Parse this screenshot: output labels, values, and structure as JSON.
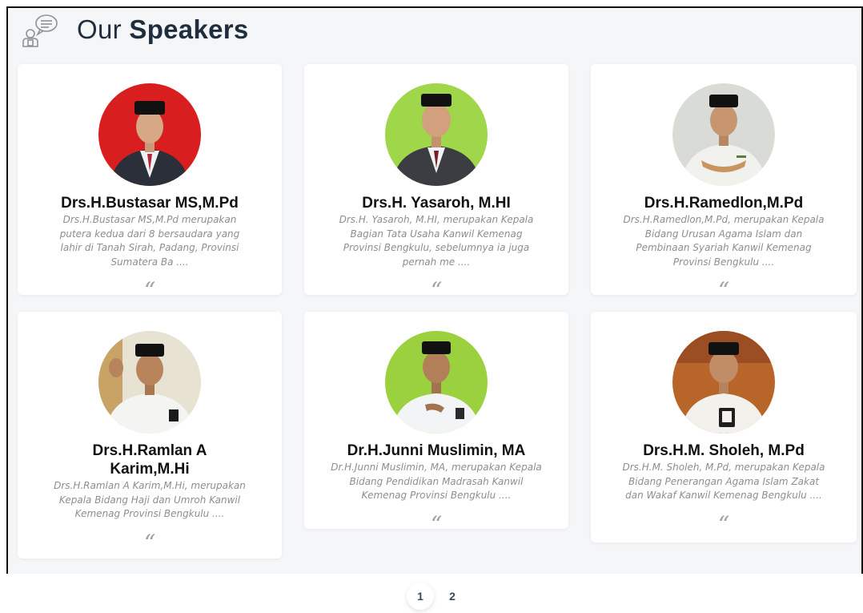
{
  "section": {
    "title_light": "Our",
    "title_bold": "Speakers",
    "icon": "speaker-chat-icon"
  },
  "speakers": [
    {
      "name": "Drs.H.Bustasar MS,M.Pd",
      "description": "Drs.H.Bustasar MS,M.Pd merupakan putera kedua dari 8 bersaudara yang lahir di Tanah Sirah, Padang, Provinsi Sumatera Ba ....",
      "quote_icon": "“",
      "photo_bg": "#d81e1e"
    },
    {
      "name": "Drs.H. Yasaroh, M.HI",
      "description": "Drs.H. Yasaroh, M.HI, merupakan Kepala Bagian Tata Usaha Kanwil Kemenag Provinsi Bengkulu, sebelumnya ia juga pernah me ....",
      "quote_icon": "“",
      "photo_bg": "#9fd64a"
    },
    {
      "name": "Drs.H.Ramedlon,M.Pd",
      "description": "Drs.H.Ramedlon,M.Pd, merupakan Kepala Bidang Urusan Agama Islam dan Pembinaan Syariah Kanwil Kemenag Provinsi Bengkulu ....",
      "quote_icon": "“",
      "photo_bg": "#d9dcd6"
    },
    {
      "name": "Drs.H.Ramlan A Karim,M.Hi",
      "description": "Drs.H.Ramlan A Karim,M.Hi, merupakan Kepala Bidang Haji dan Umroh Kanwil Kemenag Provinsi Bengkulu ....",
      "quote_icon": "“",
      "photo_bg": "#e8e2d2"
    },
    {
      "name": "Dr.H.Junni Muslimin, MA",
      "description": "Dr.H.Junni Muslimin, MA, merupakan Kepala Bidang Pendidikan Madrasah Kanwil Kemenag Provinsi Bengkulu ....",
      "quote_icon": "“",
      "photo_bg": "#9bd03e"
    },
    {
      "name": "Drs.H.M. Sholeh, M.Pd",
      "description": "Drs.H.M. Sholeh, M.Pd, merupakan Kepala Bidang Penerangan Agama Islam Zakat dan Wakaf Kanwil Kemenag Bengkulu ....",
      "quote_icon": "“",
      "photo_bg": "#b8652a"
    }
  ],
  "pagination": {
    "pages": [
      "1",
      "2"
    ],
    "current": "1"
  }
}
